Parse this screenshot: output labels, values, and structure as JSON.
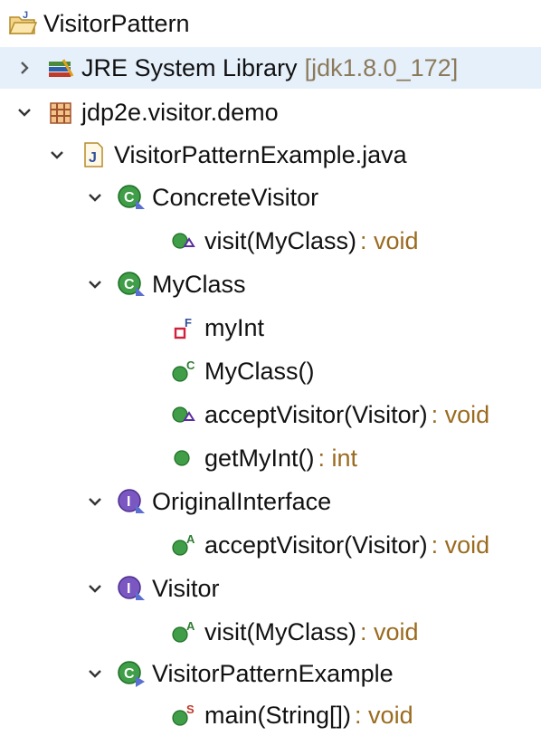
{
  "project": {
    "label": "VisitorPattern"
  },
  "jre": {
    "label": "JRE System Library",
    "decoration": "[jdk1.8.0_172]"
  },
  "package": {
    "label": "jdp2e.visitor.demo"
  },
  "file": {
    "label": "VisitorPatternExample.java"
  },
  "classes": {
    "concrete_visitor": {
      "label": "ConcreteVisitor",
      "visit": {
        "label": "visit(MyClass)",
        "type": ": void"
      }
    },
    "myclass": {
      "label": "MyClass",
      "myint": {
        "label": "myInt"
      },
      "ctor": {
        "label": "MyClass()"
      },
      "accept": {
        "label": "acceptVisitor(Visitor)",
        "type": ": void"
      },
      "getmyint": {
        "label": "getMyInt()",
        "type": ": int"
      }
    },
    "original_interface": {
      "label": "OriginalInterface",
      "accept": {
        "label": "acceptVisitor(Visitor)",
        "type": ": void"
      }
    },
    "visitor": {
      "label": "Visitor",
      "visit": {
        "label": "visit(MyClass)",
        "type": ": void"
      }
    },
    "example": {
      "label": "VisitorPatternExample",
      "main": {
        "label": "main(String[])",
        "type": ": void"
      }
    }
  }
}
